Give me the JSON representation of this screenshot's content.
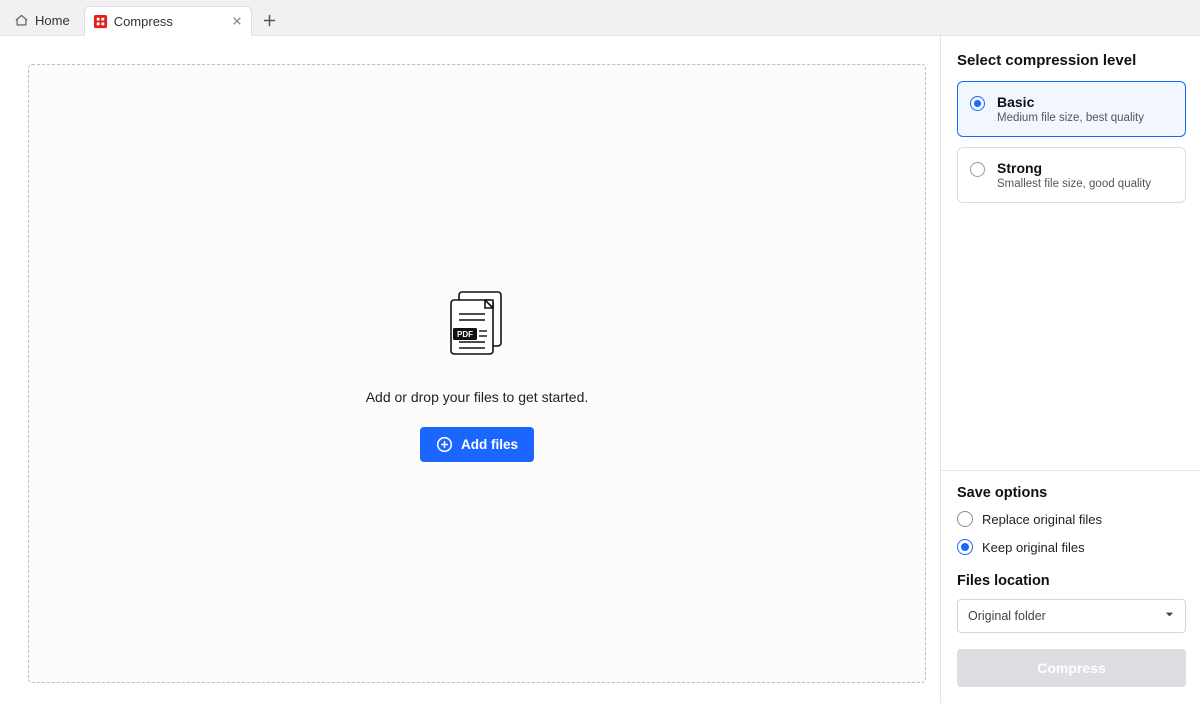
{
  "tabs": {
    "home_label": "Home",
    "active_label": "Compress"
  },
  "dropzone": {
    "message": "Add or drop your files to get started.",
    "add_files_label": "Add files"
  },
  "panel": {
    "title": "Select compression level",
    "levels": [
      {
        "title": "Basic",
        "desc": "Medium file size, best quality"
      },
      {
        "title": "Strong",
        "desc": "Smallest file size, good quality"
      }
    ],
    "save_title": "Save options",
    "save_options": {
      "replace": "Replace original files",
      "keep": "Keep original files"
    },
    "files_location_title": "Files location",
    "files_location_value": "Original folder",
    "compress_button": "Compress"
  }
}
